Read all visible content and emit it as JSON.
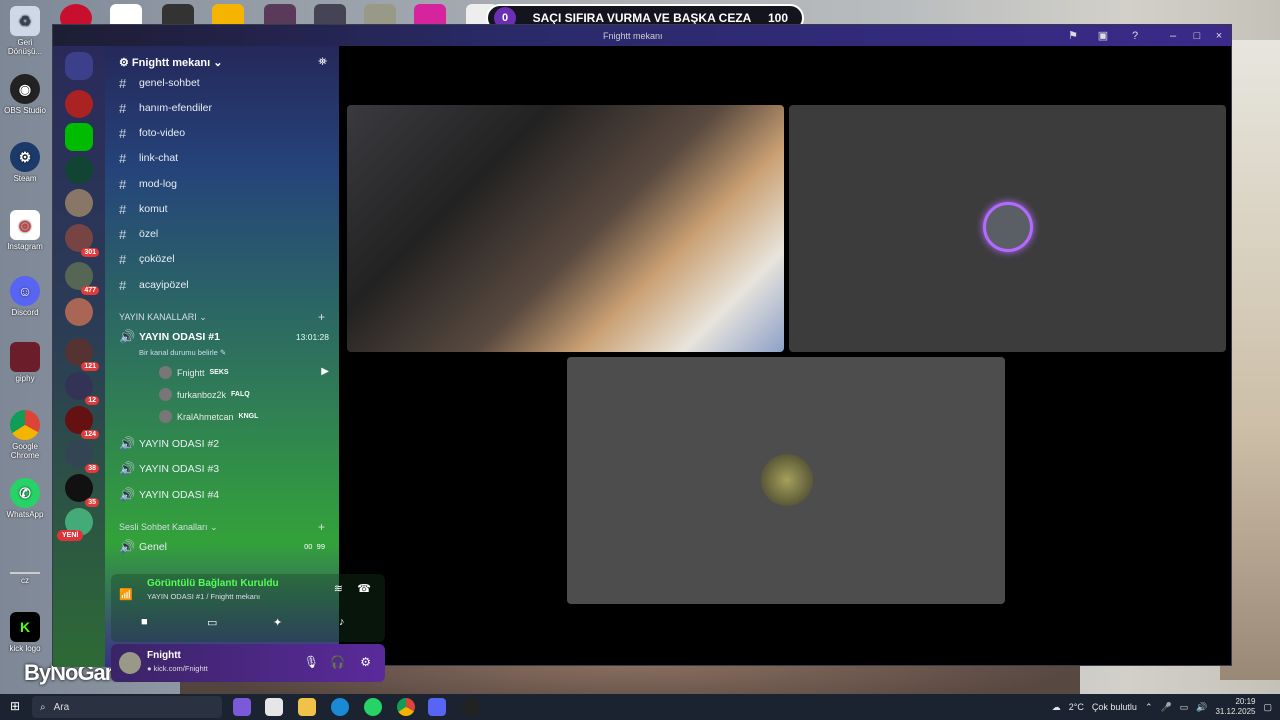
{
  "desktop": {
    "icons": [
      "Geri Dönüşü...",
      "OBS Studio",
      "Steam",
      "Instagram",
      "Discord",
      "giphy",
      "Google Chrome",
      "WhatsApp",
      "cz",
      "kick logo"
    ],
    "brand": "ByNoGame"
  },
  "banner": {
    "left": "0",
    "title": "SAÇI SIFIRA VURMA VE BAŞKA CEZA",
    "right": "100"
  },
  "window": {
    "title": "Fnightt mekanı"
  },
  "rail": {
    "badges": [
      "301",
      "477",
      "121",
      "12",
      "124",
      "38",
      "35"
    ],
    "new_label": "YENİ"
  },
  "server": {
    "name": "Fnightt mekanı"
  },
  "channels": [
    "genel-sohbet",
    "hanım-efendiler",
    "foto-video",
    "link-chat",
    "mod-log",
    "komut",
    "özel",
    "çoközel",
    "acayipözel"
  ],
  "category1": "YAYIN KANALLARI",
  "voice": {
    "active": {
      "name": "YAYIN ODASI #1",
      "time": "13:01:28",
      "status": "Bir kanal durumu belirle"
    },
    "users": [
      {
        "name": "Fnightt",
        "tag": "SEKS"
      },
      {
        "name": "furkanboz2k",
        "tag": "FALQ"
      },
      {
        "name": "KralAhmetcan",
        "tag": "KNGL"
      }
    ],
    "others": [
      "YAYIN ODASI #2",
      "YAYIN ODASI #3",
      "YAYIN ODASI #4"
    ]
  },
  "category2": "Sesli Sohbet Kanalları",
  "genel": {
    "name": "Genel",
    "left": "00",
    "right": "99"
  },
  "connection": {
    "title": "Görüntülü Bağlantı Kuruldu",
    "sub": "YAYIN ODASI #1 / Fnightt mekanı"
  },
  "user": {
    "name": "Fnightt",
    "status": "kick.com/Fnightt"
  },
  "taskbar": {
    "search": "Ara"
  },
  "weather": {
    "temp": "2°C",
    "desc": "Çok bulutlu"
  },
  "clock": {
    "time": "20:19",
    "date": "31.12.2025"
  }
}
